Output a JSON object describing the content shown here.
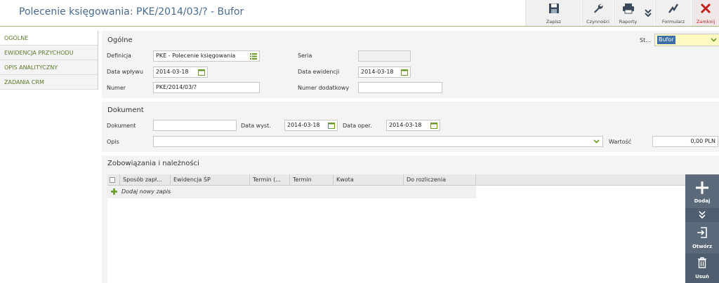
{
  "window": {
    "title": "Polecenie księgowania: PKE/2014/03/? - Bufor"
  },
  "toolbar": {
    "save": "Zapisz",
    "actions": "Czynności",
    "reports": "Raporty",
    "form": "Formularz",
    "close": "Zamknij"
  },
  "nav": {
    "items": [
      "OGÓLNE",
      "EWIDENCJA PRZYCHODU",
      "OPIS ANALITYCZNY",
      "ZADANIA CRM"
    ]
  },
  "general": {
    "title": "Ogólne",
    "status_label": "St...",
    "status_value": "Bufor",
    "definition_label": "Definicja",
    "definition_value": "PKE - Polecenie księgowania",
    "series_label": "Seria",
    "series_value": "",
    "receipt_date_label": "Data wpływu",
    "receipt_date_value": "2014-03-18",
    "record_date_label": "Data ewidencji",
    "record_date_value": "2014-03-18",
    "number_label": "Numer",
    "number_value": "PKE/2014/03/?",
    "extra_number_label": "Numer dodatkowy",
    "extra_number_value": ""
  },
  "document": {
    "title": "Dokument",
    "doc_label": "Dokument",
    "doc_value": "",
    "issue_date_label": "Data wyst.",
    "issue_date_value": "2014-03-18",
    "op_date_label": "Data oper.",
    "op_date_value": "2014-03-18",
    "desc_label": "Opis",
    "desc_value": "",
    "amount_label": "Wartość",
    "amount_value": "0,00 PLN"
  },
  "liabilities": {
    "title": "Zobowiązania i należności",
    "columns": [
      "Sposób zapł...",
      "Ewidencja ŚP",
      "Termin (...",
      "Termin",
      "Kwota",
      "Do rozliczenia"
    ],
    "add_row": "Dodaj nowy zapis"
  },
  "side_actions": {
    "add": "Dodaj",
    "open": "Otwórz",
    "delete": "Usuń"
  },
  "colors": {
    "accent_green": "#8fb14a",
    "close_red": "#c02020",
    "side_panel": "#5a6a7a"
  }
}
